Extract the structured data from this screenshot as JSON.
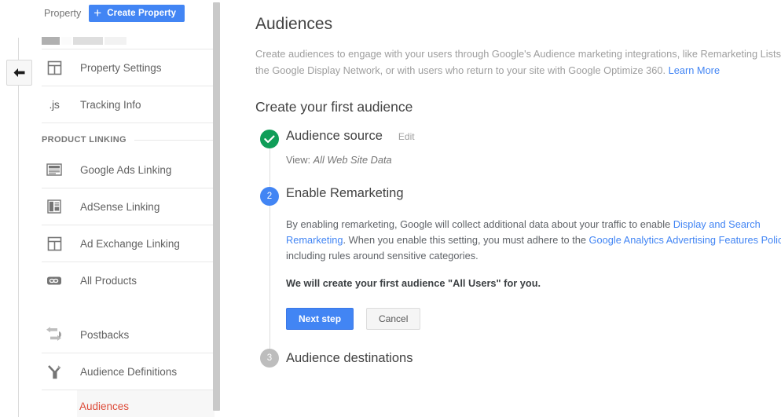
{
  "sidebar": {
    "property_label": "Property",
    "create_property_button": "Create Property",
    "back_icon": "back-arrow-icon",
    "section_heading": "PRODUCT LINKING",
    "items": [
      {
        "label": "Property Settings",
        "icon": "property-settings-icon"
      },
      {
        "label": "Tracking Info",
        "icon": "js-icon"
      },
      {
        "label": "Google Ads Linking",
        "icon": "google-ads-icon"
      },
      {
        "label": "AdSense Linking",
        "icon": "adsense-icon"
      },
      {
        "label": "Ad Exchange Linking",
        "icon": "ad-exchange-icon"
      },
      {
        "label": "All Products",
        "icon": "link-chain-icon"
      },
      {
        "label": "Postbacks",
        "icon": "postbacks-arrows-icon"
      },
      {
        "label": "Audience Definitions",
        "icon": "audience-definitions-icon"
      }
    ],
    "active_sub_item": "Audiences",
    "active_color": "#dd4b39"
  },
  "main": {
    "title": "Audiences",
    "description_line1": "Create audiences to engage with your users through Google's Audience marketing integrations, like Remarketing Lists",
    "description_line2": "the Google Display Network, or with users who return to your site with Google Optimize 360. ",
    "description_link": "Learn More",
    "section_title": "Create your first audience",
    "steps": [
      {
        "badge": "check",
        "title": "Audience source",
        "edit_label": "Edit",
        "sub_prefix": "View: ",
        "sub_value": "All Web Site Data"
      },
      {
        "badge": "2",
        "title": "Enable Remarketing",
        "para_part1": "By enabling remarketing, Google will collect additional data about your traffic to enable ",
        "para_link1": "Display and Search Remarketing",
        "para_part2": ". When you enable this setting, you must adhere to the ",
        "para_link2": "Google Analytics Advertising Features Policy",
        "para_part3": ", including rules around sensitive categories.",
        "bold_note": "We will create your first audience \"All Users\" for you.",
        "primary_button": "Next step",
        "secondary_button": "Cancel"
      },
      {
        "badge": "3",
        "title": "Audience destinations"
      }
    ]
  },
  "colors": {
    "accent_blue": "#4285f4",
    "success_green": "#0f9d58",
    "idle_gray": "#bdbdbd",
    "link_blue": "#4285f4",
    "active_nav": "#dd4b39"
  }
}
